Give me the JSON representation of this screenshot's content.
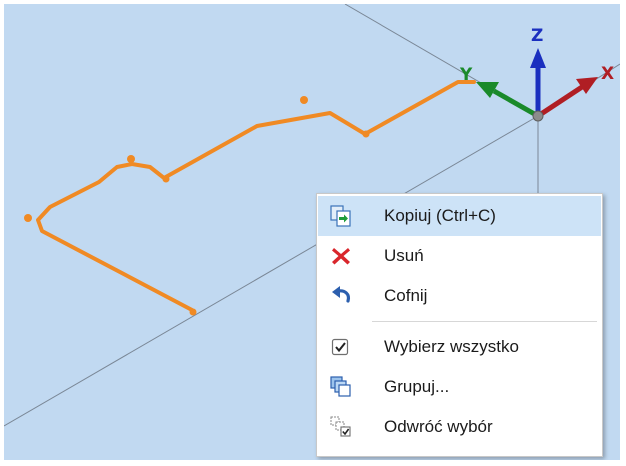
{
  "viewport": {
    "background_color": "#c1d9f1",
    "path_color": "#f08a24",
    "axes": {
      "x_label": "X",
      "y_label": "Y",
      "z_label": "Z",
      "x_color": "#b01e24",
      "y_color": "#1a8a2a",
      "z_color": "#1a2fbf"
    }
  },
  "context_menu": {
    "items": [
      {
        "label": "Kopiuj (Ctrl+C)",
        "icon": "copy-icon",
        "highlighted": true
      },
      {
        "label": "Usuń",
        "icon": "delete-icon"
      },
      {
        "label": "Cofnij",
        "icon": "undo-icon"
      },
      {
        "label": "Wybierz wszystko",
        "icon": "select-all-icon"
      },
      {
        "label": "Grupuj...",
        "icon": "group-icon"
      },
      {
        "label": "Odwróć wybór",
        "icon": "invert-selection-icon"
      }
    ]
  }
}
